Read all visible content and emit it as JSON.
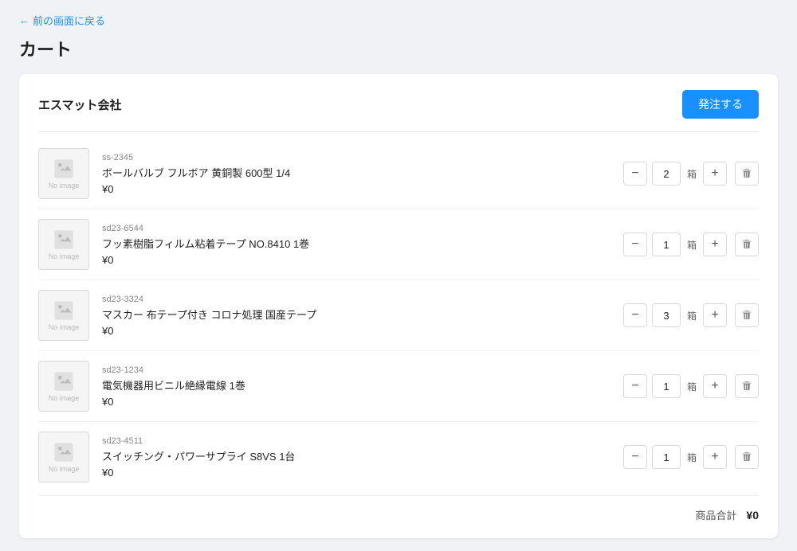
{
  "back_link": "前の画面に戻る",
  "page_title": "カート",
  "company": "エスマット会社",
  "order_button": "発注する",
  "no_image": "No image",
  "items": [
    {
      "sku": "ss-2345",
      "name": "ボールバルブ フルボア 黄銅製 600型 1/4",
      "price": "¥0",
      "quantity": 2,
      "unit": "箱"
    },
    {
      "sku": "sd23-6544",
      "name": "フッ素樹脂フィルム粘着テープ NO.8410 1巻",
      "price": "¥0",
      "quantity": 1,
      "unit": "箱"
    },
    {
      "sku": "sd23-3324",
      "name": "マスカー 布テープ付き コロナ処理 国産テープ",
      "price": "¥0",
      "quantity": 3,
      "unit": "箱"
    },
    {
      "sku": "sd23-1234",
      "name": "電気機器用ビニル絶縁電線 1巻",
      "price": "¥0",
      "quantity": 1,
      "unit": "箱"
    },
    {
      "sku": "sd23-4511",
      "name": "スイッチング・パワーサプライ S8VS 1台",
      "price": "¥0",
      "quantity": 1,
      "unit": "箱"
    }
  ],
  "footer": {
    "total_label": "商品合計",
    "total_value": "¥0"
  }
}
